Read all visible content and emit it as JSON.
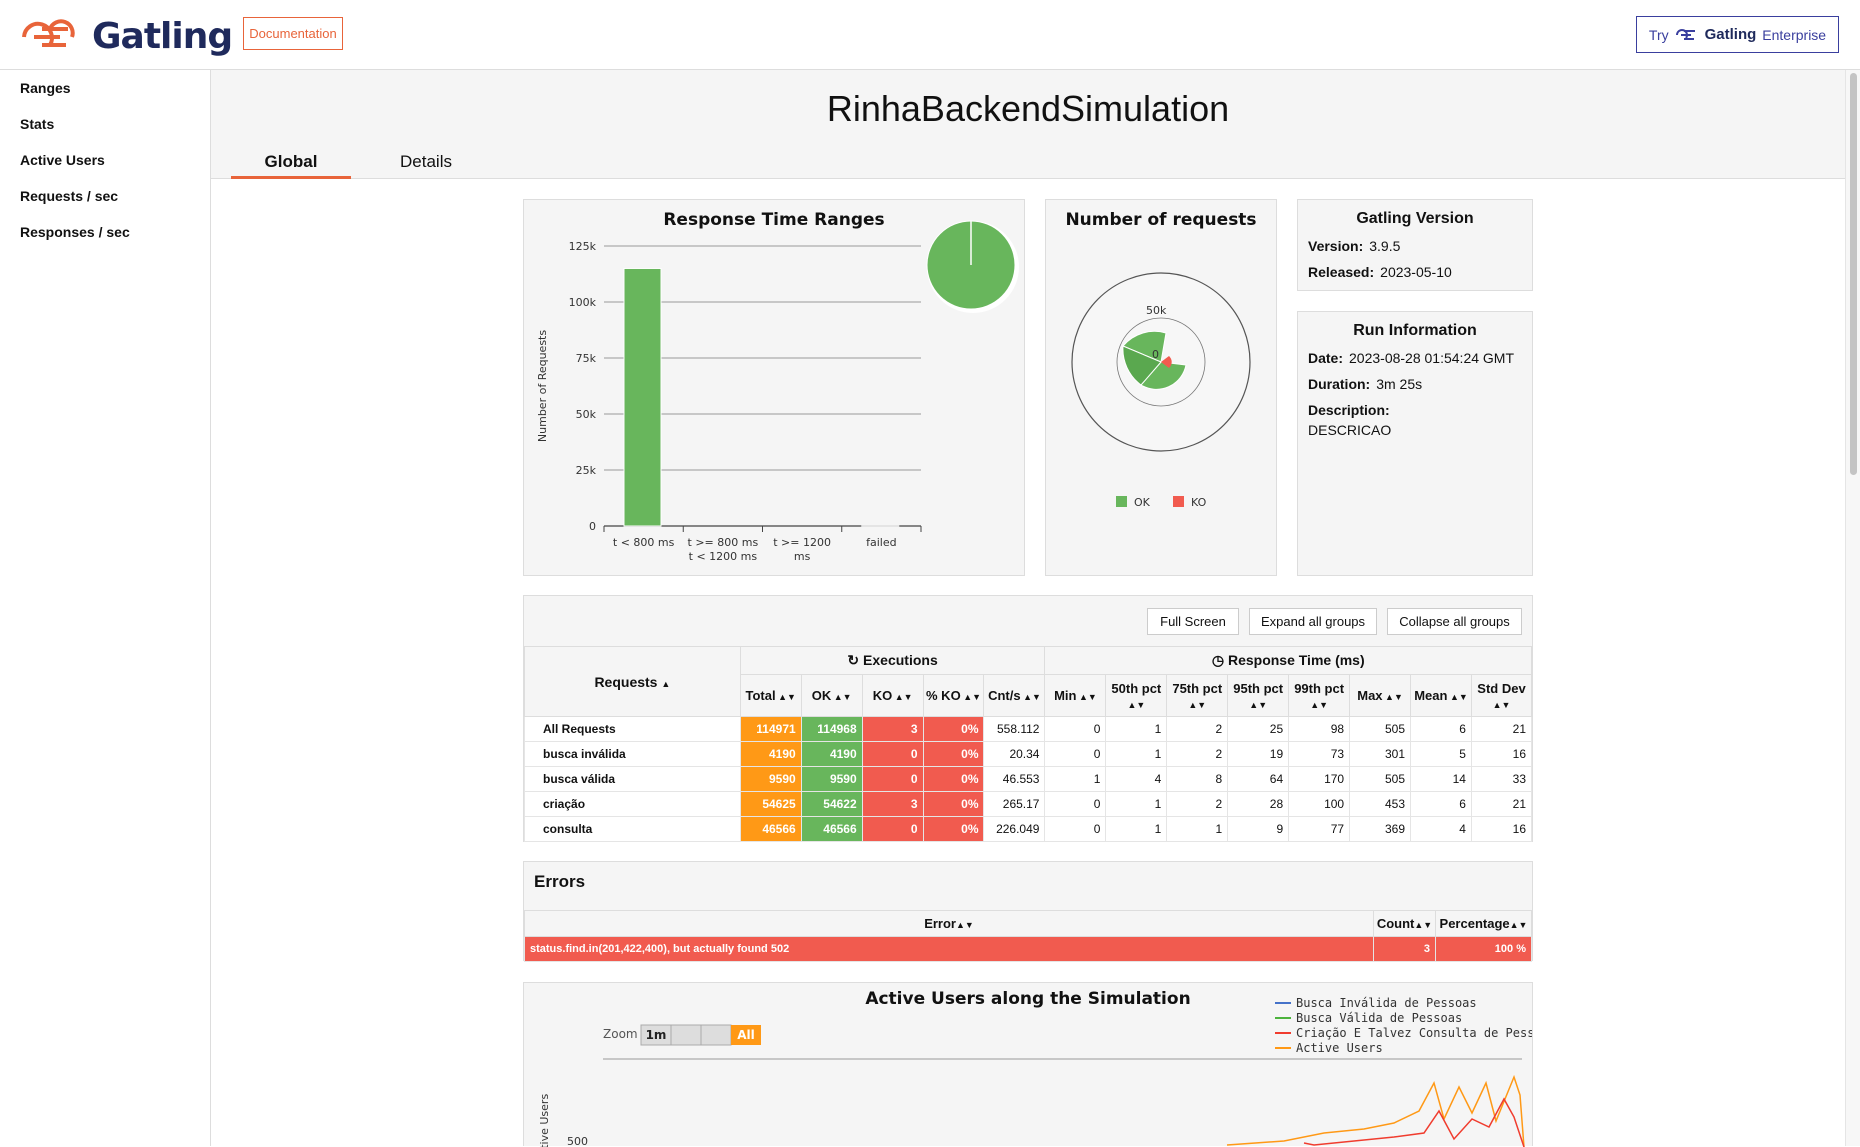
{
  "brand": {
    "name": "Gatling"
  },
  "header": {
    "documentation": "Documentation",
    "enterprise_try": "Try",
    "enterprise_brand": "Gatling",
    "enterprise_label": "Enterprise"
  },
  "sidebar": {
    "items": [
      {
        "label": "Ranges"
      },
      {
        "label": "Stats"
      },
      {
        "label": "Active Users"
      },
      {
        "label": "Requests / sec"
      },
      {
        "label": "Responses / sec"
      }
    ]
  },
  "page": {
    "title": "RinhaBackendSimulation"
  },
  "tabs": [
    {
      "label": "Global",
      "active": true
    },
    {
      "label": "Details",
      "active": false
    }
  ],
  "ranges_chart": {
    "title": "Response Time Ranges",
    "ylabel": "Number of Requests",
    "categories": [
      "t < 800 ms",
      "t >= 800 ms\nt < 1200 ms",
      "t >= 1200\nms",
      "failed"
    ],
    "values": [
      114968,
      0,
      0,
      3
    ],
    "yticks": [
      "0",
      "25k",
      "50k",
      "75k",
      "100k",
      "125k"
    ],
    "ylim": [
      0,
      125000
    ],
    "colors": {
      "ok": "#68b65c",
      "ko": "#f15b4f"
    }
  },
  "requests_chart": {
    "title": "Number of requests",
    "tick_50k": "50k",
    "tick_0": "0",
    "legend_ok": "OK",
    "legend_ko": "KO"
  },
  "gatling_version": {
    "title": "Gatling Version",
    "version_label": "Version:",
    "version": "3.9.5",
    "released_label": "Released:",
    "released": "2023-05-10"
  },
  "run_info": {
    "title": "Run Information",
    "date_label": "Date:",
    "date": "2023-08-28 01:54:24 GMT",
    "duration_label": "Duration:",
    "duration": "3m 25s",
    "description_label": "Description:",
    "description": "DESCRICAO"
  },
  "stats_toolbar": {
    "full_screen": "Full Screen",
    "expand": "Expand all groups",
    "collapse": "Collapse all groups"
  },
  "stats_table": {
    "requests_header": "Requests",
    "executions_header": "Executions",
    "response_time_header": "Response Time (ms)",
    "columns": [
      "Total",
      "OK",
      "KO",
      "% KO",
      "Cnt/s",
      "Min",
      "50th pct",
      "75th pct",
      "95th pct",
      "99th pct",
      "Max",
      "Mean",
      "Std Dev"
    ],
    "rows": [
      {
        "name": "All Requests",
        "total": "114971",
        "ok": "114968",
        "ko": "3",
        "pko": "0%",
        "cnts": "558.112",
        "min": "0",
        "p50": "1",
        "p75": "2",
        "p95": "25",
        "p99": "98",
        "max": "505",
        "mean": "6",
        "std": "21"
      },
      {
        "name": "busca inválida",
        "total": "4190",
        "ok": "4190",
        "ko": "0",
        "pko": "0%",
        "cnts": "20.34",
        "min": "0",
        "p50": "1",
        "p75": "2",
        "p95": "19",
        "p99": "73",
        "max": "301",
        "mean": "5",
        "std": "16"
      },
      {
        "name": "busca válida",
        "total": "9590",
        "ok": "9590",
        "ko": "0",
        "pko": "0%",
        "cnts": "46.553",
        "min": "1",
        "p50": "4",
        "p75": "8",
        "p95": "64",
        "p99": "170",
        "max": "505",
        "mean": "14",
        "std": "33"
      },
      {
        "name": "criação",
        "total": "54625",
        "ok": "54622",
        "ko": "3",
        "pko": "0%",
        "cnts": "265.17",
        "min": "0",
        "p50": "1",
        "p75": "2",
        "p95": "28",
        "p99": "100",
        "max": "453",
        "mean": "6",
        "std": "21"
      },
      {
        "name": "consulta",
        "total": "46566",
        "ok": "46566",
        "ko": "0",
        "pko": "0%",
        "cnts": "226.049",
        "min": "0",
        "p50": "1",
        "p75": "1",
        "p95": "9",
        "p99": "77",
        "max": "369",
        "mean": "4",
        "std": "16"
      }
    ]
  },
  "errors": {
    "title": "Errors",
    "col_error": "Error",
    "col_count": "Count",
    "col_percentage": "Percentage",
    "rows": [
      {
        "error": "status.find.in(201,422,400), but actually found 502",
        "count": "3",
        "percentage": "100 %"
      }
    ]
  },
  "active_users_chart": {
    "title": "Active Users along the Simulation",
    "zoom_label": "Zoom",
    "zoom_1m": "1m",
    "zoom_all": "All",
    "ylabel": "Active Users",
    "ytick": "500",
    "legend": [
      {
        "name": "Busca Inválida de Pessoas",
        "color": "#4572c9"
      },
      {
        "name": "Busca Válida de Pessoas",
        "color": "#4db33d"
      },
      {
        "name": "Criação E Talvez Consulta de Pessoas",
        "color": "#f03c2e"
      },
      {
        "name": "Active Users",
        "color": "#ff9916"
      }
    ]
  }
}
